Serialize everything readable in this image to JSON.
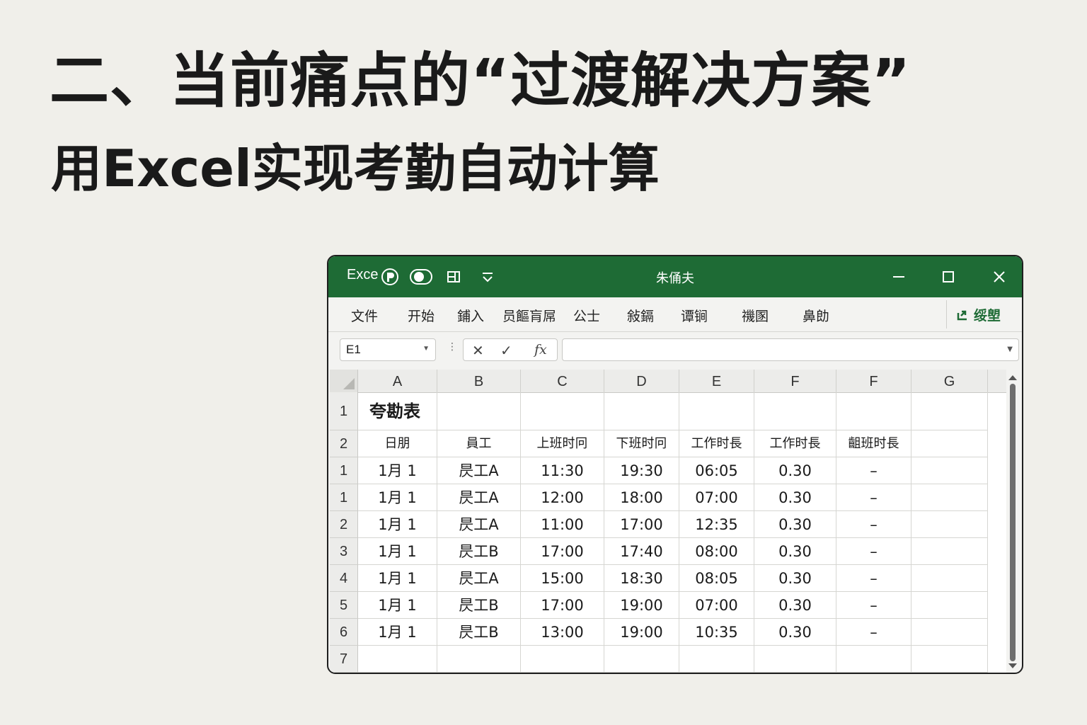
{
  "headline": "二、当前痛点的“过渡解决方案”",
  "subheadline": "用Excel实现考勤自动计算",
  "window": {
    "app_name": "Exce",
    "doc_title": "朱俑夫",
    "menu": [
      "文件",
      "开始",
      "鋪入",
      "员饇肓屌",
      "公士",
      "敍鎘",
      "谭锏",
      "禨圂",
      "鼻勆"
    ],
    "share_label": "绥塱",
    "name_box": "E1",
    "fx_label": "fx",
    "formula_value": ""
  },
  "sheet": {
    "columns": [
      "A",
      "B",
      "C",
      "D",
      "E",
      "F",
      "F",
      "G"
    ],
    "title_row": {
      "row_number": "1",
      "title": "夸勘表"
    },
    "header_row": {
      "row_number": "2",
      "cells": [
        "日朋",
        "員工",
        "上班时冋",
        "下班时冋",
        "工作时長",
        "工作时長",
        "齟班时長",
        ""
      ]
    },
    "rows": [
      {
        "row_number": "1",
        "cells": [
          "1月 1",
          "昃工A",
          "11:30",
          "19:30",
          "06:05",
          "0.30",
          "–",
          ""
        ]
      },
      {
        "row_number": "1",
        "cells": [
          "1月 1",
          "昃工A",
          "12:00",
          "18:00",
          "07:00",
          "0.30",
          "–",
          ""
        ]
      },
      {
        "row_number": "2",
        "cells": [
          "1月 1",
          "昃工A",
          "11:00",
          "17:00",
          "12:35",
          "0.30",
          "–",
          ""
        ]
      },
      {
        "row_number": "3",
        "cells": [
          "1月 1",
          "昃工B",
          "17:00",
          "17:40",
          "08:00",
          "0.30",
          "–",
          ""
        ]
      },
      {
        "row_number": "4",
        "cells": [
          "1月 1",
          "昃工A",
          "15:00",
          "18:30",
          "08:05",
          "0.30",
          "–",
          ""
        ]
      },
      {
        "row_number": "5",
        "cells": [
          "1月 1",
          "昃工B",
          "17:00",
          "19:00",
          "07:00",
          "0.30",
          "–",
          ""
        ]
      },
      {
        "row_number": "6",
        "cells": [
          "1月 1",
          "昃工B",
          "13:00",
          "19:00",
          "10:35",
          "0.30",
          "–",
          ""
        ]
      },
      {
        "row_number": "7",
        "cells": [
          "",
          "",
          "",
          "",
          "",
          "",
          "",
          ""
        ]
      }
    ]
  },
  "colors": {
    "titlebar": "#1e6b35",
    "background": "#f0efea",
    "accent_green": "#1e6b35"
  }
}
